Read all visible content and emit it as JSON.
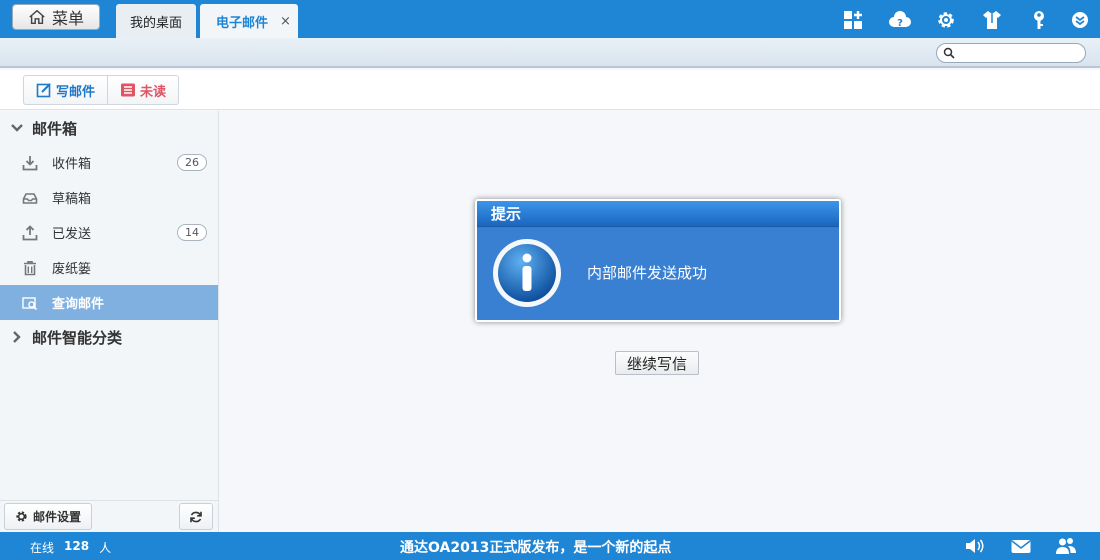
{
  "topbar": {
    "menu_label": "菜单",
    "tabs": [
      {
        "label": "我的桌面"
      },
      {
        "label": "电子邮件",
        "close": "×"
      }
    ],
    "icons": [
      "add-app-icon",
      "help-cloud-icon",
      "gear-icon",
      "shirt-icon",
      "key-icon",
      "chevron-down-icon"
    ]
  },
  "search": {
    "placeholder": ""
  },
  "toolbar": {
    "compose_label": "写邮件",
    "unread_label": "未读"
  },
  "sidebar": {
    "mailbox_title": "邮件箱",
    "items": [
      {
        "label": "收件箱",
        "count": "26",
        "icon": "download-tray-icon"
      },
      {
        "label": "草稿箱",
        "icon": "inbox-tray-icon"
      },
      {
        "label": "已发送",
        "count": "14",
        "icon": "upload-tray-icon"
      },
      {
        "label": "废纸篓",
        "icon": "trash-icon"
      },
      {
        "label": "查询邮件",
        "icon": "search-mail-icon"
      }
    ],
    "smart_title": "邮件智能分类",
    "settings_label": "邮件设置"
  },
  "dialog": {
    "title": "提示",
    "message": "内部邮件发送成功",
    "continue_label": "继续写信"
  },
  "statusbar": {
    "online_label": "在线",
    "online_count": "128",
    "online_unit": "人",
    "news": "通达OA2013正式版发布，是一个新的起点"
  },
  "colors": {
    "brand_blue": "#1f86d6",
    "active_item": "#7fb0e0",
    "dialog_blue": "#3a80d2",
    "unread_red": "#e05464"
  }
}
